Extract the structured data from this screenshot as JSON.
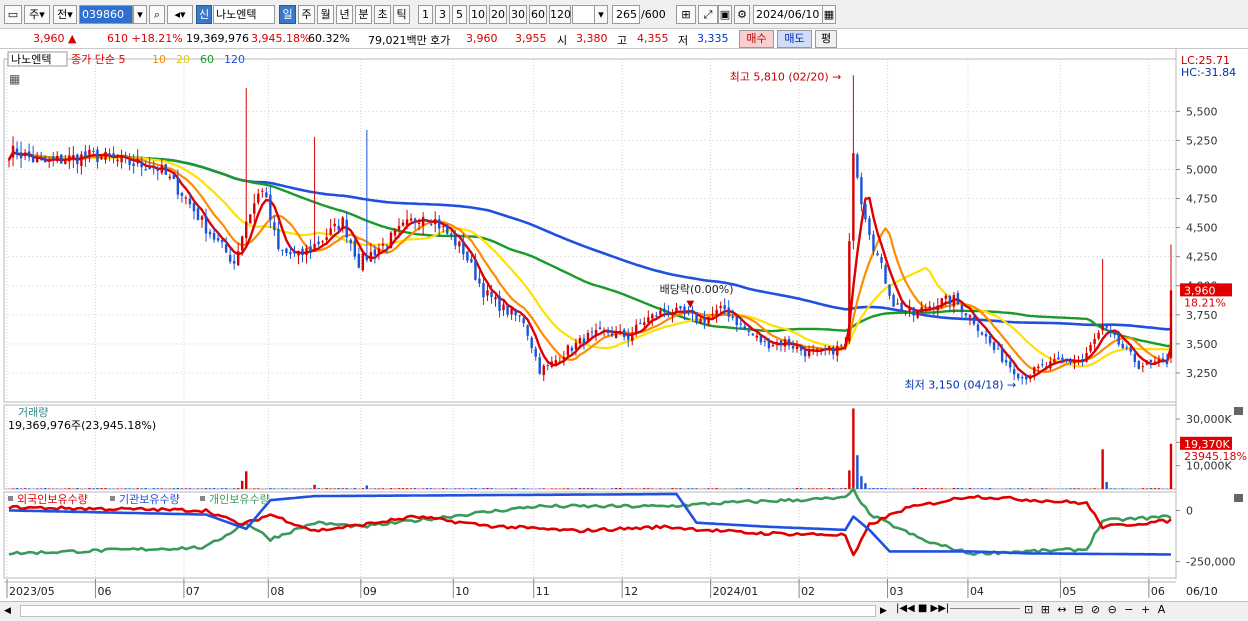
{
  "toolbar": {
    "market": "주",
    "prev": "전",
    "code": "039860",
    "new_badge": "신",
    "stock_name": "나노엔텍",
    "periods": [
      "일",
      "주",
      "월",
      "년",
      "분",
      "초",
      "틱"
    ],
    "active_period": "일",
    "intervals": [
      "1",
      "3",
      "5",
      "10",
      "20",
      "30",
      "60",
      "120"
    ],
    "count": "265",
    "count_total": "/600",
    "date": "2024/06/10"
  },
  "quote": {
    "price": "3,960",
    "change_arrow": "▲",
    "change": "610",
    "change_pct": "+18.21%",
    "volume": "19,369,976",
    "volume_ratio": "3,945.18%",
    "turnover": "60.32%",
    "amount": "79,021백만",
    "bid_label": "호가",
    "bid1": "3,960",
    "bid2": "3,955",
    "open_label": "시",
    "open": "3,380",
    "high_label": "고",
    "high": "4,355",
    "low_label": "저",
    "low": "3,335",
    "buy_label": "매수",
    "sell_label": "매도",
    "eval_label": "평"
  },
  "colors": {
    "up": "#d60000",
    "down": "#1a53d8",
    "ma5": "#e00000",
    "ma10": "#ff8c00",
    "ma20": "#ffe000",
    "ma60": "#1a9a28",
    "ma120": "#2050e0",
    "foreign": "#e00000",
    "institution": "#2050e0",
    "individual": "#3a9a5a"
  },
  "chart_data": [
    {
      "type": "candlestick",
      "legend": {
        "stock": "나노엔텍",
        "prefix": "종가 단순",
        "ma_periods": [
          "5",
          "10",
          "20",
          "60",
          "120"
        ]
      },
      "ylim": [
        3000,
        5950
      ],
      "y_ticks": [
        {
          "value": 5500,
          "label": "5,500"
        },
        {
          "value": 5250,
          "label": "5,250"
        },
        {
          "value": 5000,
          "label": "5,000"
        },
        {
          "value": 4750,
          "label": "4,750"
        },
        {
          "value": 4500,
          "label": "4,500"
        },
        {
          "value": 4250,
          "label": "4,250"
        },
        {
          "value": 4000,
          "label": "4,000"
        },
        {
          "value": 3750,
          "label": "3,750"
        },
        {
          "value": 3500,
          "label": "3,500"
        },
        {
          "value": 3250,
          "label": "3,250"
        }
      ],
      "lc": "LC:25.71",
      "hc": "HC:-31.84",
      "current_value": 3960,
      "current_label": "3,960",
      "current_pct": "18.21%",
      "annotations": {
        "high": {
          "label": "최고 5,810 (02/20)",
          "date": "2024-02-20",
          "value": 5810
        },
        "low": {
          "label": "최저 3,150 (04/18)",
          "date": "2024-04-18",
          "value": 3150
        },
        "dividend": {
          "label": "배당락(0.00%)",
          "date": "2023-12-27",
          "value": 3730
        }
      },
      "close_anchors": [
        [
          "2023-05-04",
          5150
        ],
        [
          "2023-05-12",
          5050
        ],
        [
          "2023-05-22",
          5090
        ],
        [
          "2023-05-31",
          5120
        ],
        [
          "2023-06-12",
          5060
        ],
        [
          "2023-06-22",
          5020
        ],
        [
          "2023-06-30",
          4800
        ],
        [
          "2023-07-10",
          4500
        ],
        [
          "2023-07-19",
          4200
        ],
        [
          "2023-07-24",
          4560
        ],
        [
          "2023-07-28",
          4850
        ],
        [
          "2023-08-03",
          4300
        ],
        [
          "2023-08-10",
          4250
        ],
        [
          "2023-08-18",
          4400
        ],
        [
          "2023-08-25",
          4550
        ],
        [
          "2023-08-31",
          4200
        ],
        [
          "2023-09-08",
          4350
        ],
        [
          "2023-09-15",
          4500
        ],
        [
          "2023-09-22",
          4620
        ],
        [
          "2023-09-27",
          4560
        ],
        [
          "2023-10-06",
          4300
        ],
        [
          "2023-10-13",
          3950
        ],
        [
          "2023-10-20",
          3800
        ],
        [
          "2023-10-27",
          3700
        ],
        [
          "2023-11-02",
          3280
        ],
        [
          "2023-11-06",
          3300
        ],
        [
          "2023-11-13",
          3450
        ],
        [
          "2023-11-20",
          3560
        ],
        [
          "2023-11-27",
          3600
        ],
        [
          "2023-12-04",
          3560
        ],
        [
          "2023-12-08",
          3700
        ],
        [
          "2023-12-15",
          3780
        ],
        [
          "2023-12-21",
          3760
        ],
        [
          "2023-12-28",
          3700
        ],
        [
          "2024-01-05",
          3800
        ],
        [
          "2024-01-12",
          3620
        ],
        [
          "2024-01-19",
          3500
        ],
        [
          "2024-01-26",
          3520
        ],
        [
          "2024-02-02",
          3430
        ],
        [
          "2024-02-08",
          3420
        ],
        [
          "2024-02-16",
          3480
        ],
        [
          "2024-02-20",
          5200
        ],
        [
          "2024-02-22",
          4750
        ],
        [
          "2024-02-27",
          4350
        ],
        [
          "2024-03-05",
          3850
        ],
        [
          "2024-03-12",
          3750
        ],
        [
          "2024-03-19",
          3850
        ],
        [
          "2024-03-26",
          3880
        ],
        [
          "2024-04-02",
          3700
        ],
        [
          "2024-04-09",
          3450
        ],
        [
          "2024-04-18",
          3210
        ],
        [
          "2024-04-25",
          3300
        ],
        [
          "2024-05-02",
          3350
        ],
        [
          "2024-05-09",
          3360
        ],
        [
          "2024-05-16",
          3640
        ],
        [
          "2024-05-22",
          3500
        ],
        [
          "2024-05-29",
          3320
        ],
        [
          "2024-06-05",
          3330
        ],
        [
          "2024-06-07",
          3350
        ],
        [
          "2024-06-10",
          3960
        ]
      ],
      "spikes": [
        {
          "date": "2023-07-24",
          "high": 5700
        },
        {
          "date": "2023-08-16",
          "high": 5280
        },
        {
          "date": "2023-09-04",
          "high": 5340
        },
        {
          "date": "2024-02-20",
          "high": 5810
        },
        {
          "date": "2024-05-16",
          "high": 4230
        },
        {
          "date": "2024-06-10",
          "high": 4355
        }
      ]
    },
    {
      "type": "bar",
      "title": "거래량",
      "value_label": "19,369,976주(23,945.18%)",
      "ylim": [
        0,
        36000
      ],
      "y_ticks": [
        {
          "value": 30000,
          "label": "30,000K"
        },
        {
          "value": 20000,
          "label": "20,000K"
        },
        {
          "value": 10000,
          "label": "10,000K"
        }
      ],
      "current_label": "19,370K",
      "current_value": 19370,
      "current_pct": "23945.18%",
      "spikes": [
        {
          "date": "2023-07-21",
          "value": 3500
        },
        {
          "date": "2023-07-24",
          "value": 7600
        },
        {
          "date": "2023-08-16",
          "value": 1800
        },
        {
          "date": "2023-09-04",
          "value": 1500
        },
        {
          "date": "2024-02-19",
          "value": 8000
        },
        {
          "date": "2024-02-20",
          "value": 34500
        },
        {
          "date": "2024-02-21",
          "value": 14500
        },
        {
          "date": "2024-02-22",
          "value": 5500
        },
        {
          "date": "2024-02-23",
          "value": 2500
        },
        {
          "date": "2024-05-16",
          "value": 17000
        },
        {
          "date": "2024-05-17",
          "value": 3000
        },
        {
          "date": "2024-06-10",
          "value": 19370
        }
      ]
    },
    {
      "type": "line",
      "series_names": [
        "외국인보유수량",
        "기관보유수량",
        "개인보유수량"
      ],
      "ylim": [
        -330000,
        90000
      ],
      "y_ticks": [
        {
          "value": 0,
          "label": "0"
        },
        {
          "value": -250000,
          "label": "-250,000"
        }
      ]
    }
  ],
  "x_axis": {
    "start": "2023-05-02",
    "end": "2024-06-10",
    "labels": [
      {
        "date": "2023-05-02",
        "label": "2023/05"
      },
      {
        "date": "2023-06-01",
        "label": "06"
      },
      {
        "date": "2023-07-03",
        "label": "07"
      },
      {
        "date": "2023-08-01",
        "label": "08"
      },
      {
        "date": "2023-09-01",
        "label": "09"
      },
      {
        "date": "2023-10-04",
        "label": "10"
      },
      {
        "date": "2023-11-01",
        "label": "11"
      },
      {
        "date": "2023-12-01",
        "label": "12"
      },
      {
        "date": "2024-01-02",
        "label": "2024/01"
      },
      {
        "date": "2024-02-01",
        "label": "02"
      },
      {
        "date": "2024-03-04",
        "label": "03"
      },
      {
        "date": "2024-04-01",
        "label": "04"
      },
      {
        "date": "2024-05-02",
        "label": "05"
      },
      {
        "date": "2024-06-03",
        "label": "06"
      }
    ],
    "right_label": "06/10"
  }
}
